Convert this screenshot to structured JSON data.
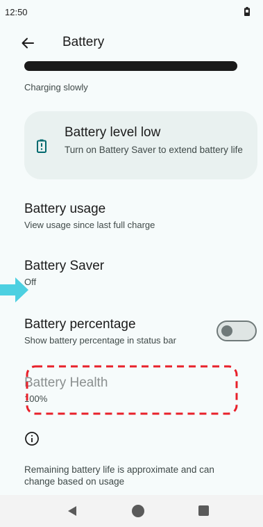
{
  "status_bar": {
    "time": "12:50",
    "battery_icon": "battery-icon"
  },
  "app_bar": {
    "back_icon": "arrow-left-icon",
    "title": "Battery"
  },
  "battery_status": {
    "charging_text": "Charging slowly"
  },
  "tip_card": {
    "icon": "battery-alert-icon",
    "title": "Battery level low",
    "summary": "Turn on Battery Saver to extend battery life"
  },
  "preferences": {
    "battery_usage": {
      "title": "Battery usage",
      "summary": "View usage since last full charge"
    },
    "battery_saver": {
      "title": "Battery Saver",
      "summary": "Off"
    },
    "battery_percentage": {
      "title": "Battery percentage",
      "summary": "Show battery percentage in status bar",
      "toggle_state": "off"
    },
    "battery_health": {
      "title": "Battery Health",
      "summary": "100%"
    }
  },
  "footer": {
    "info_icon": "info-icon",
    "text": "Remaining battery life is approximate and can change based on usage"
  },
  "nav_bar": {
    "back_icon": "nav-back-icon",
    "home_icon": "nav-home-icon",
    "recents_icon": "nav-recents-icon"
  },
  "colors": {
    "background": "#f6fbfb",
    "card": "#e9f1f0",
    "accent_teal": "#00696e",
    "arrow": "#4dd0e1",
    "highlight_dash": "#e8202a"
  }
}
